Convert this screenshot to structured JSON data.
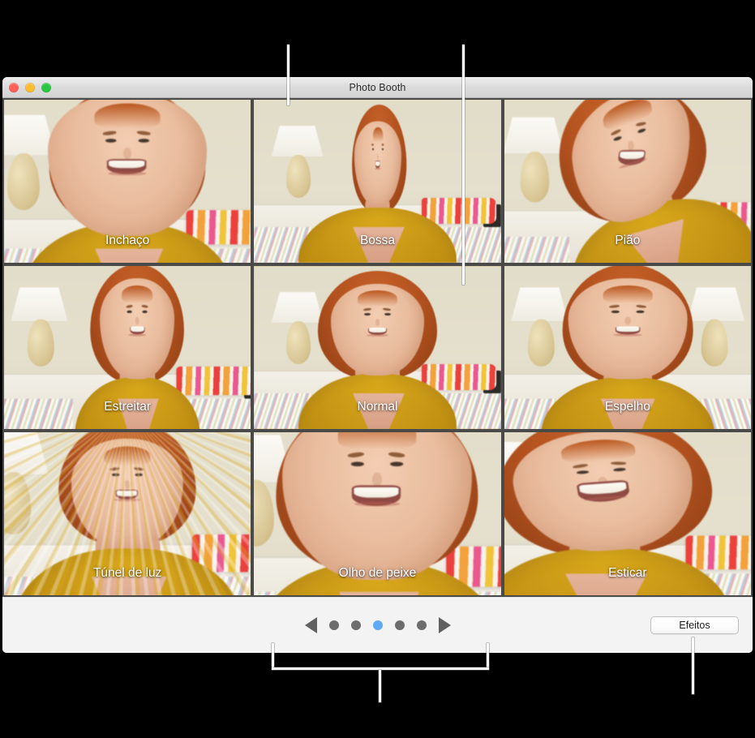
{
  "window": {
    "title": "Photo Booth",
    "traffic_lights": [
      {
        "name": "close",
        "color": "#ff5f57"
      },
      {
        "name": "minimize",
        "color": "#ffbd2e"
      },
      {
        "name": "maximize",
        "color": "#28c840"
      }
    ]
  },
  "effects_grid": {
    "columns": 3,
    "rows": 3,
    "selected": "Normal",
    "cells": [
      {
        "label": "Inchaço",
        "fx": "fx-bulge",
        "selected": false
      },
      {
        "label": "Bossa",
        "fx": "fx-dent",
        "selected": false
      },
      {
        "label": "Pião",
        "fx": "fx-twirl",
        "selected": false
      },
      {
        "label": "Estreitar",
        "fx": "fx-squeeze",
        "selected": false
      },
      {
        "label": "Normal",
        "fx": "fx-normal",
        "selected": true
      },
      {
        "label": "Espelho",
        "fx": "fx-mirror",
        "selected": false
      },
      {
        "label": "Túnel de luz",
        "fx": "fx-tunnel",
        "selected": false
      },
      {
        "label": "Olho de peixe",
        "fx": "fx-fisheye",
        "selected": false
      },
      {
        "label": "Esticar",
        "fx": "fx-stretch",
        "selected": false
      }
    ]
  },
  "toolbar": {
    "prev_icon": "triangle-left-icon",
    "next_icon": "triangle-right-icon",
    "page_count": 5,
    "current_page": 3,
    "dot_active_color": "#5fa9f5",
    "dot_inactive_color": "#6d6d6d",
    "effects_button_label": "Efeitos"
  },
  "callouts": {
    "top_left": "leader-line-to-effects-grid",
    "top_right": "leader-line-to-selected-effect",
    "bottom_bracket": "leader-bracket-to-page-dots",
    "bottom_right": "leader-line-to-effects-button"
  }
}
